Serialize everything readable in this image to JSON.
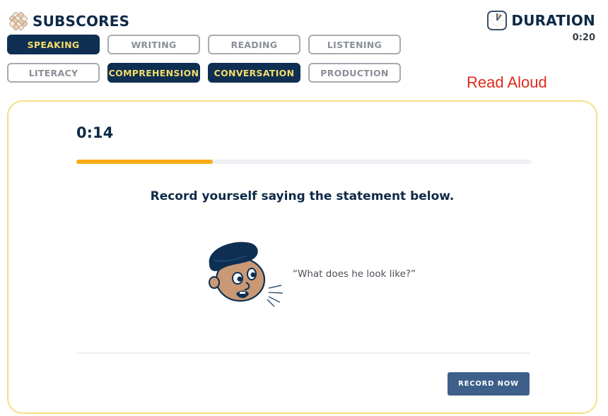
{
  "header": {
    "title": "SUBSCORES",
    "logo_icon": "diamond-grid-logo-icon",
    "duration_label": "DURATION",
    "duration_icon": "clock-icon",
    "duration_value": "0:20"
  },
  "subscores": [
    {
      "label": "SPEAKING",
      "active": true
    },
    {
      "label": "WRITING",
      "active": false
    },
    {
      "label": "READING",
      "active": false
    },
    {
      "label": "LISTENING",
      "active": false
    },
    {
      "label": "LITERACY",
      "active": false
    },
    {
      "label": "COMPREHENSION",
      "active": true
    },
    {
      "label": "CONVERSATION",
      "active": true
    },
    {
      "label": "PRODUCTION",
      "active": false
    }
  ],
  "annotation": "Read Aloud",
  "question": {
    "timer": "0:14",
    "progress_percent": 30,
    "instruction": "Record yourself saying the statement below.",
    "illustration": "speaking-person-icon",
    "statement": "“What does he look like?”",
    "record_label": "RECORD NOW"
  },
  "colors": {
    "navy": "#0e2f52",
    "active_text": "#f3dc6a",
    "progress": "#f7ac14",
    "card_border": "#f5df86",
    "button": "#3d5f8a",
    "annotation": "#e02a1d"
  }
}
